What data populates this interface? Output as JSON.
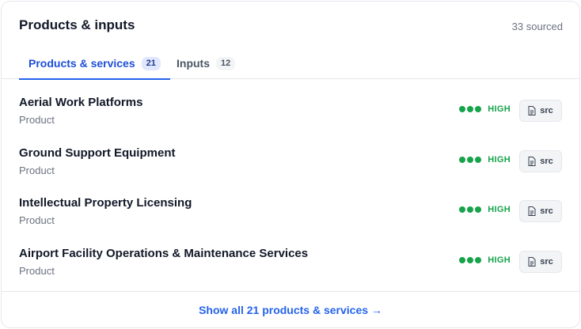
{
  "header": {
    "title": "Products & inputs",
    "sourced": "33 sourced"
  },
  "tabs": [
    {
      "label": "Products & services",
      "count": "21",
      "active": true
    },
    {
      "label": "Inputs",
      "count": "12",
      "active": false
    }
  ],
  "items": [
    {
      "name": "Aerial Work Platforms",
      "type": "Product",
      "confidence": "HIGH",
      "source_label": "src"
    },
    {
      "name": "Ground Support Equipment",
      "type": "Product",
      "confidence": "HIGH",
      "source_label": "src"
    },
    {
      "name": "Intellectual Property Licensing",
      "type": "Product",
      "confidence": "HIGH",
      "source_label": "src"
    },
    {
      "name": "Airport Facility Operations & Maintenance Services",
      "type": "Product",
      "confidence": "HIGH",
      "source_label": "src"
    }
  ],
  "footer": {
    "show_all": "Show all 21 products & services →"
  },
  "colors": {
    "accent": "#2563eb",
    "high": "#16a34a"
  },
  "icons": {
    "source": "document-icon",
    "confidence": "confidence-dots"
  }
}
